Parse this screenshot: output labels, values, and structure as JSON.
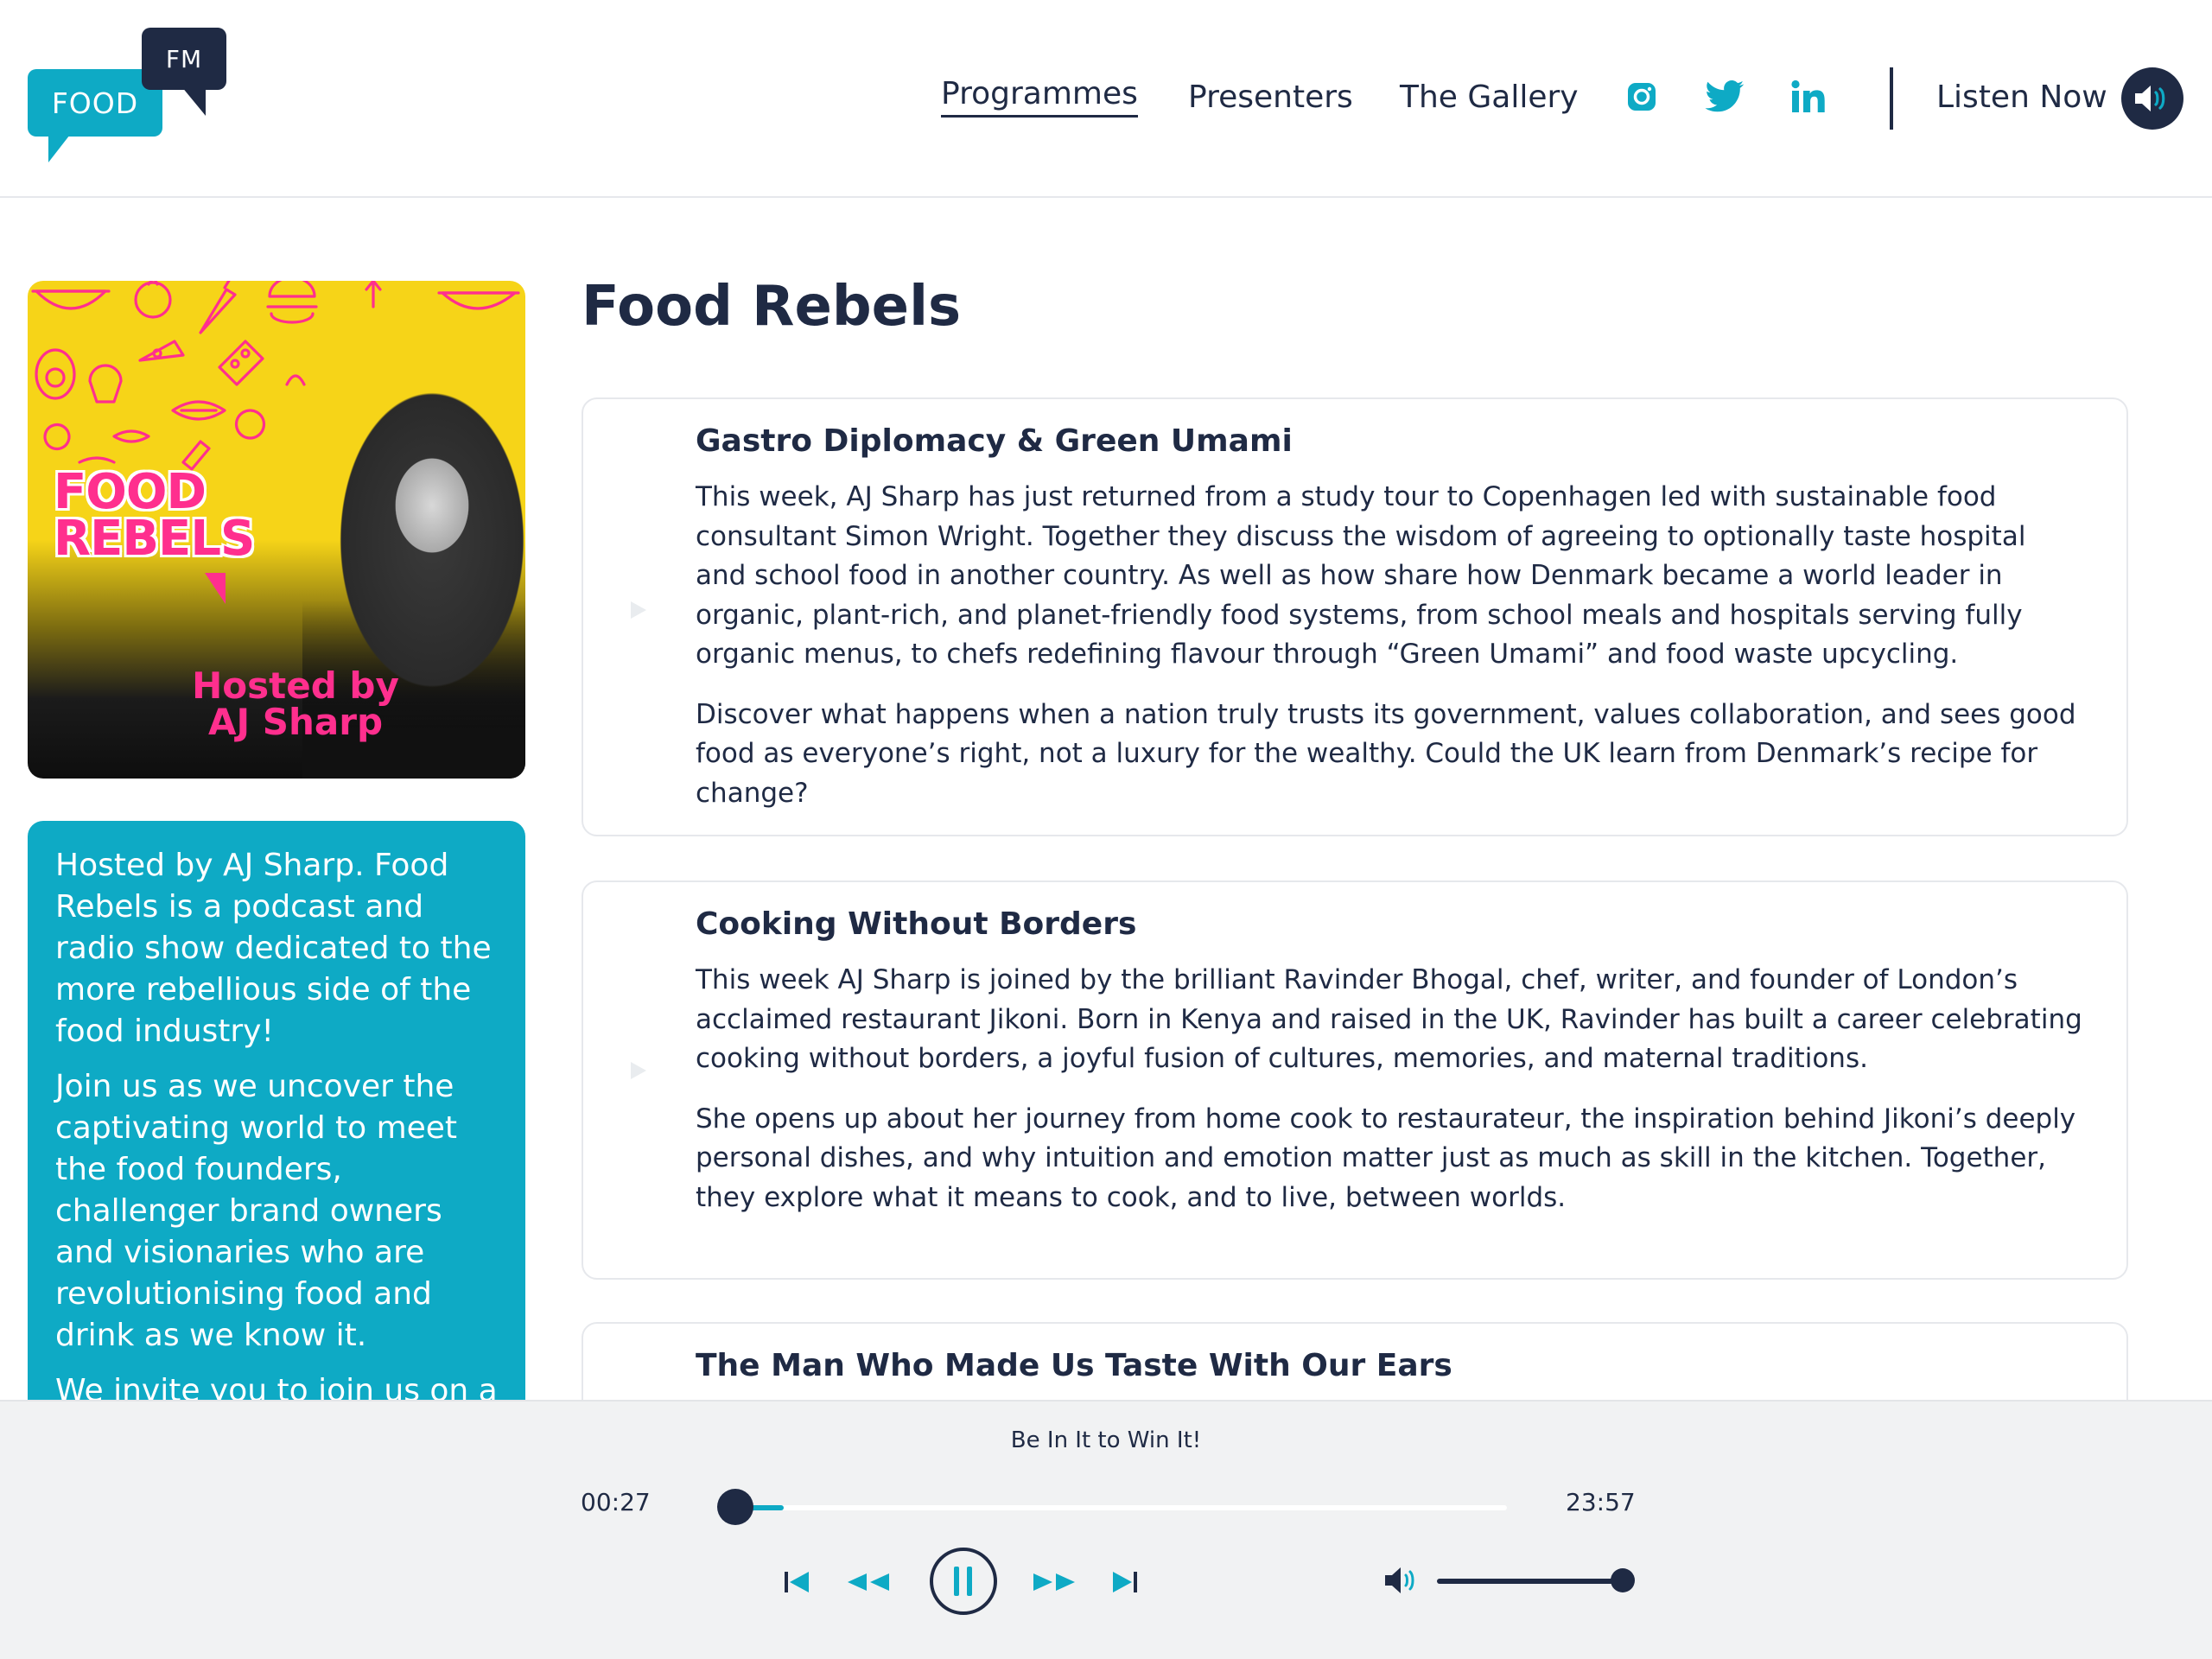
{
  "brand": {
    "logo_food": "FOOD",
    "logo_fm": "FM",
    "accent": "#0eaac5",
    "navy": "#1f2a44",
    "pink": "#ff2f8e"
  },
  "nav": {
    "items": [
      {
        "label": "Programmes",
        "active": true
      },
      {
        "label": "Presenters",
        "active": false
      },
      {
        "label": "The Gallery",
        "active": false
      }
    ],
    "social": [
      "instagram-icon",
      "twitter-icon",
      "linkedin-icon"
    ],
    "listen_label": "Listen Now"
  },
  "sidebar": {
    "cover": {
      "title": "FOOD REBELS",
      "title_line1": "FOOD",
      "title_line2": "REBELS",
      "host_line1": "Hosted by",
      "host_line2": "AJ Sharp"
    },
    "about": [
      "Hosted by AJ Sharp. Food Rebels is a podcast and radio show dedicated to the more rebellious side of the food industry!",
      "Join us as we uncover the captivating world to meet the food founders, challenger brand owners and visionaries who are revolutionising food and drink as we know it.",
      "We invite you to join us on a"
    ]
  },
  "main": {
    "title": "Food Rebels",
    "episodes": [
      {
        "title": "Gastro Diplomacy & Green Umami",
        "paragraphs": [
          "This week, AJ Sharp has just returned from a study tour to Copenhagen led with sustainable food consultant Simon Wright. Together they discuss the wisdom of agreeing to optionally taste hospital and school food in another country. As well as how share how Denmark became a world leader in organic, plant-rich, and planet-friendly food systems, from school meals and hospitals serving fully organic menus, to chefs redefining flavour through “Green Umami” and food waste upcycling.",
          "Discover what happens when a nation truly trusts its government, values collaboration, and sees good food as everyone’s right, not a luxury for the wealthy. Could the UK learn from Denmark’s recipe for change?"
        ]
      },
      {
        "title": "Cooking Without Borders",
        "paragraphs": [
          "This week AJ Sharp is joined by the brilliant Ravinder Bhogal, chef, writer, and founder of London’s acclaimed restaurant Jikoni. Born in Kenya and raised in the UK, Ravinder has built a career celebrating cooking without borders, a joyful fusion of cultures, memories, and maternal traditions.",
          "She opens up about her journey from home cook to restaurateur, the inspiration behind Jikoni’s deeply personal dishes, and why intuition and emotion matter just as much as skill in the kitchen. Together, they explore what it means to cook, and to live, between worlds."
        ]
      },
      {
        "title": "The Man Who Made Us Taste With Our Ears",
        "paragraphs": []
      }
    ]
  },
  "player": {
    "now_playing": "Be In It to Win It!",
    "current_time": "00:27",
    "total_time": "23:57",
    "progress": 0.019,
    "volume": 1.0,
    "state": "playing"
  }
}
